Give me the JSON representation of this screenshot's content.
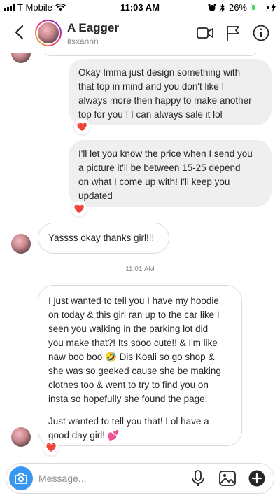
{
  "status_bar": {
    "carrier": "T-Mobile",
    "time": "11:03 AM",
    "battery_text": "26%",
    "battery_level": 0.26
  },
  "header": {
    "name": "A Eagger",
    "username": "itsxannn",
    "icons": [
      "back-chevron-icon",
      "video-call-icon",
      "flag-icon",
      "info-icon"
    ]
  },
  "messages": {
    "out1": {
      "lines": [
        "Okay Imma just design something with",
        "that top in mind and you don't like I",
        "always more then happy to make another",
        "top for you ! I can always sale it lol"
      ],
      "reaction": "❤️"
    },
    "out2": {
      "lines": [
        "I'll let you know the price when I send you",
        "a picture it'll be between 15-25 depend",
        "on what I come up with! I'll keep you",
        "updated"
      ],
      "reaction": "❤️"
    },
    "in1": {
      "text": "Yassss okay thanks girl!!!"
    },
    "timestamp": "11:01 AM",
    "in2": {
      "lines_p1": [
        "I just wanted to tell you I have my hoodie",
        "on today & this girl ran up to the car like I",
        "seen you walking in the parking lot did",
        "you make that?! Its sooo cute!! & I'm like",
        "naw boo boo 🤣 Dis Koali so go shop &",
        "she was so geeked cause she be making",
        "clothes too & went to try to find you on",
        "insta so hopefully she found the page!"
      ],
      "lines_p2": [
        "Just wanted to tell you that! Lol have a",
        "good day girl! 💕"
      ],
      "reaction": "❤️"
    }
  },
  "composer": {
    "placeholder": "Message...",
    "icons": [
      "camera-icon",
      "microphone-icon",
      "gallery-icon",
      "plus-icon"
    ]
  },
  "colors": {
    "accent_blue": "#3897f0",
    "bubble_gray": "#efefef",
    "heart_red": "#ed4956",
    "battery_green": "#4cd964"
  }
}
